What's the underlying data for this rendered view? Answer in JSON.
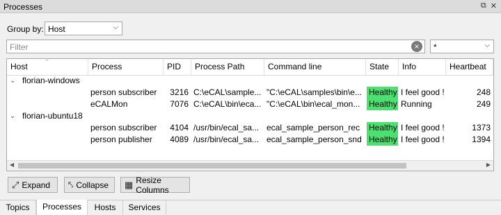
{
  "window": {
    "title": "Processes"
  },
  "groupby": {
    "label": "Group by:",
    "value": "Host"
  },
  "filter": {
    "placeholder": "Filter",
    "combo_value": "*"
  },
  "table": {
    "columns": [
      "Host",
      "Process",
      "PID",
      "Process Path",
      "Command line",
      "State",
      "Info",
      "Heartbeat"
    ],
    "groups": [
      {
        "host": "florian-windows",
        "rows": [
          {
            "process": "person subscriber",
            "pid": "3216",
            "path": "C:\\eCAL\\sample...",
            "cmd": "\"C:\\eCAL\\samples\\bin\\e...",
            "state": "Healthy",
            "info": "I feel good !",
            "heartbeat": "248"
          },
          {
            "process": "eCALMon",
            "pid": "7076",
            "path": "C:\\eCAL\\bin\\eca...",
            "cmd": "\"C:\\eCAL\\bin\\ecal_mon...",
            "state": "Healthy",
            "info": "Running",
            "heartbeat": "249"
          }
        ]
      },
      {
        "host": "florian-ubuntu18",
        "rows": [
          {
            "process": "person subscriber",
            "pid": "4104",
            "path": "/usr/bin/ecal_sa...",
            "cmd": "ecal_sample_person_rec",
            "state": "Healthy",
            "info": "I feel good !",
            "heartbeat": "1373"
          },
          {
            "process": "person publisher",
            "pid": "4089",
            "path": "/usr/bin/ecal_sa...",
            "cmd": "ecal_sample_person_snd",
            "state": "Healthy",
            "info": "I feel good !",
            "heartbeat": "1394"
          }
        ]
      }
    ]
  },
  "buttons": {
    "expand": "Expand",
    "collapse": "Collapse",
    "resize": "Resize Columns"
  },
  "tabs": [
    {
      "label": "Topics"
    },
    {
      "label": "Processes"
    },
    {
      "label": "Hosts"
    },
    {
      "label": "Services"
    }
  ]
}
